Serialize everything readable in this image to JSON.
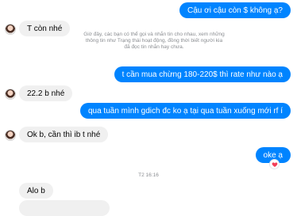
{
  "messages": {
    "m1": "Cậu ơi cậu còn $ không ạ?",
    "m2": "T còn nhé",
    "notice": "Giờ đây, các bạn có thể gọi và nhắn tin cho nhau, xem những thông tin như Trạng thái hoạt động, đồng thời biết người kia đã đọc tin nhắn hay chưa.",
    "m3": "t cần mua chừng 180-220$ thì rate như nào ạ",
    "m4": "22.2 b nhé",
    "m5": "qua tuần mình gdich đc ko ạ tại qua tuần xuống mới rf í",
    "m6": "Ok b, cần thì ib t nhé",
    "m7": "oke ạ",
    "timestamp": "T2 16:16",
    "m8": "Alo b"
  },
  "reaction_icon": "heart-icon",
  "colors": {
    "outgoing": "#0084ff",
    "incoming": "#f0f0f0",
    "reaction": "#f33e58"
  }
}
